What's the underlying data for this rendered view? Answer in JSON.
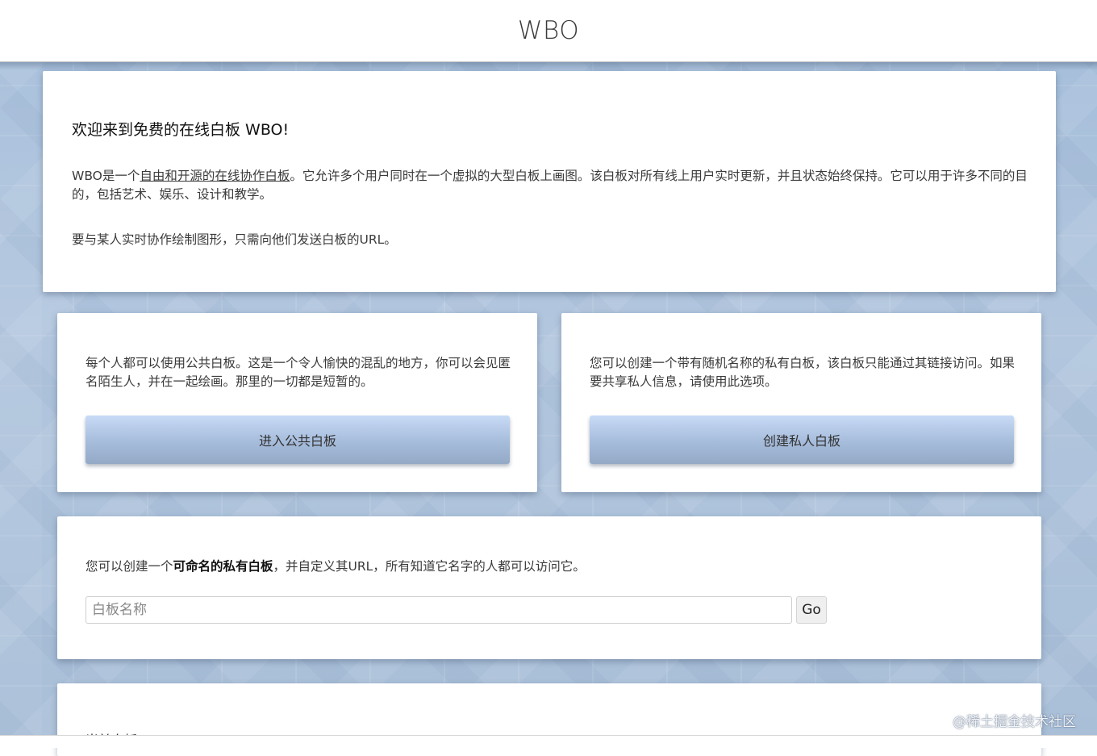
{
  "header": {
    "title": "WBO"
  },
  "welcome": {
    "heading": "欢迎来到免费的在线白板 WBO!",
    "p1_prefix": "WBO是一个",
    "p1_link": "自由和开源的在线协作白板",
    "p1_suffix": "。它允许多个用户同时在一个虚拟的大型白板上画图。该白板对所有线上用户实时更新，并且状态始终保持。它可以用于许多不同的目的，包括艺术、娱乐、设计和教学。",
    "p2": "要与某人实时协作绘制图形，只需向他们发送白板的URL。"
  },
  "public_board": {
    "description": "每个人都可以使用公共白板。这是一个令人愉快的混乱的地方，你可以会见匿名陌生人，并在一起绘画。那里的一切都是短暂的。",
    "button_label": "进入公共白板"
  },
  "private_board": {
    "description": "您可以创建一个带有随机名称的私有白板，该白板只能通过其链接访问。如果要共享私人信息，请使用此选项。",
    "button_label": "创建私人白板"
  },
  "named_board": {
    "text_prefix": "您可以创建一个",
    "text_bold": "可命名的私有白板",
    "text_suffix": "，并自定义其URL，所有知道它名字的人都可以访问它。",
    "input_placeholder": "白板名称",
    "input_value": "",
    "go_label": "Go"
  },
  "recent": {
    "heading": "当前白板"
  },
  "watermark": {
    "text": "@稀土掘金技术社区"
  }
}
